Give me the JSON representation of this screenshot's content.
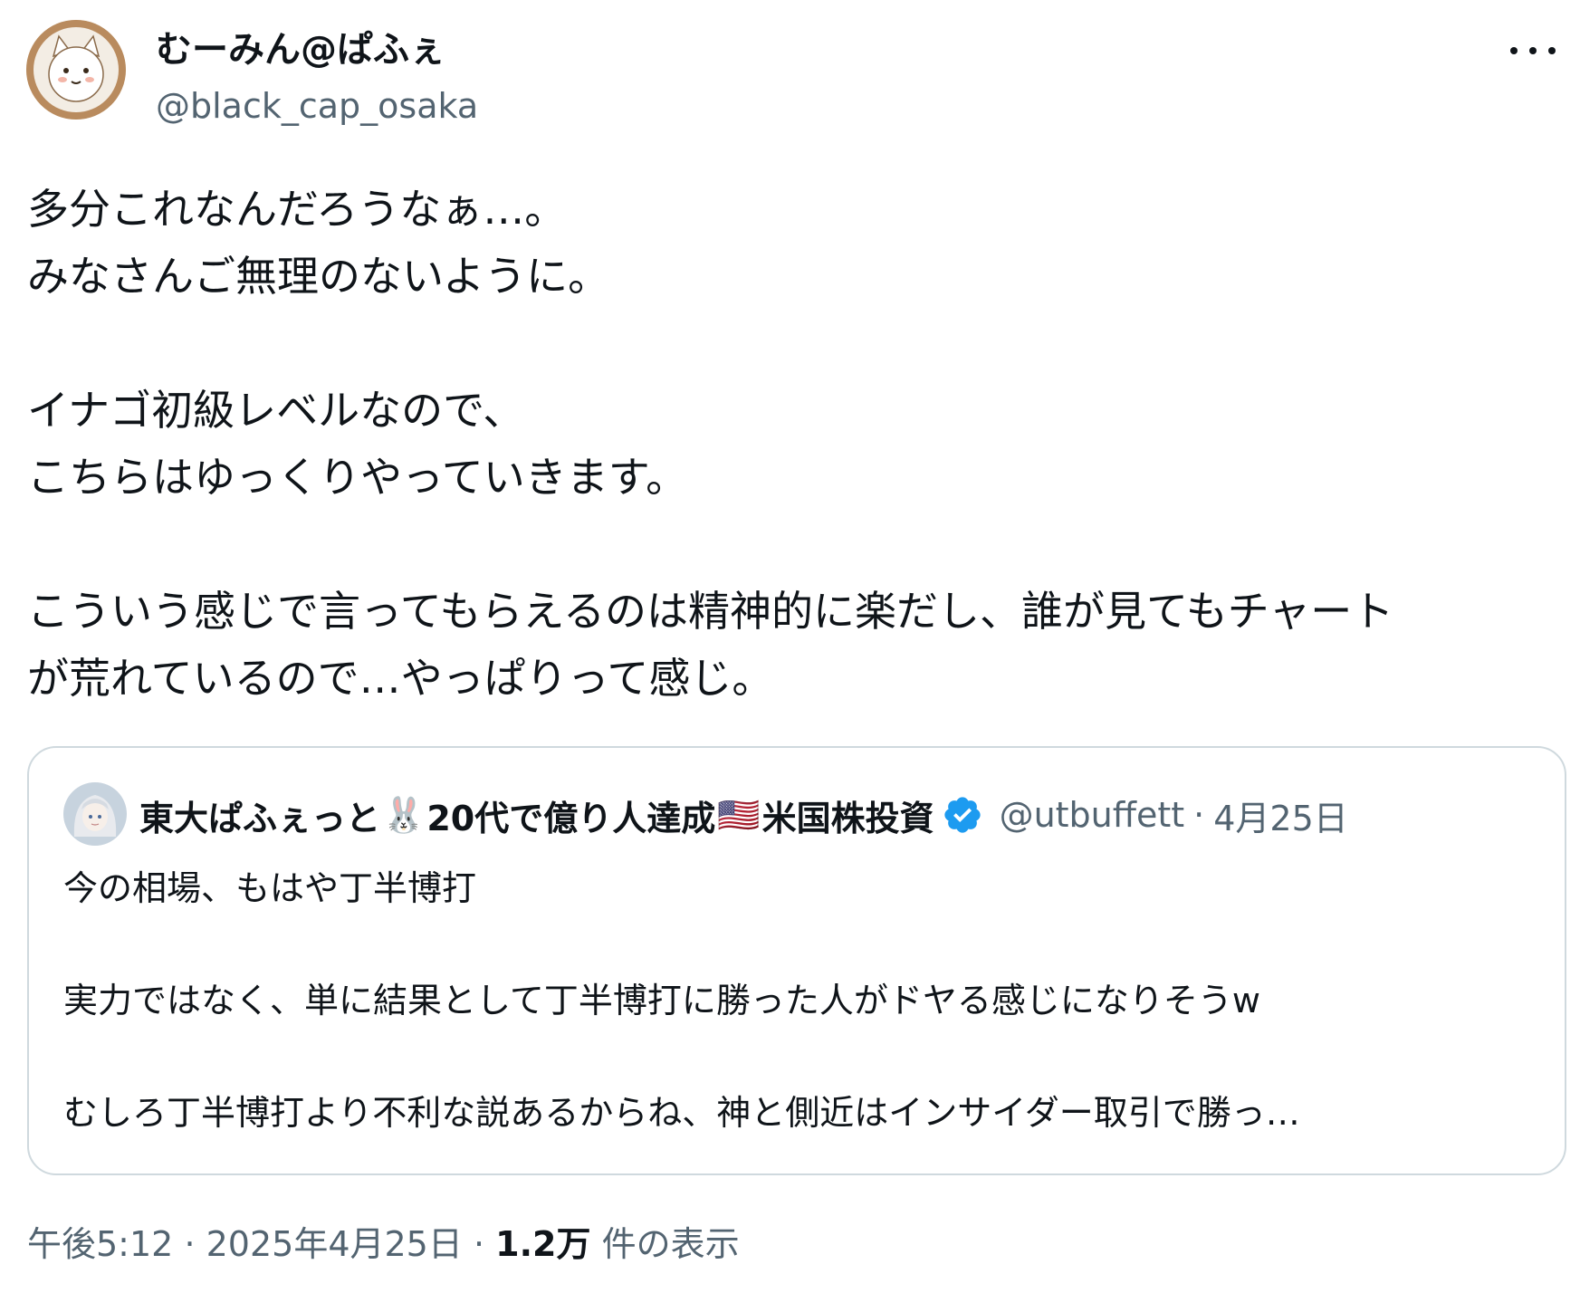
{
  "author": {
    "display_name": "むーみん@ぱふぇ",
    "handle": "@black_cap_osaka",
    "avatar_icon": "cat-avatar-icon"
  },
  "more_icon": "more-horizontal-icon",
  "tweet": {
    "lines": [
      "多分これなんだろうなぁ…。",
      "みなさんご無理のないように。",
      "",
      "イナゴ初級レベルなので、",
      "こちらはゆっくりやっていきます。",
      "",
      "こういう感じで言ってもらえるのは精神的に楽だし、誰が見てもチャート",
      "が荒れているので…やっぱりって感じ。"
    ]
  },
  "quote": {
    "name_part1": "東大ぱふぇっと",
    "emoji_rabbit": "🐰",
    "name_part2": "20代で億り人達成",
    "emoji_flag": "🇺🇸",
    "name_part3": "米国株投資",
    "verified_icon": "verified-badge-icon",
    "handle": "@utbuffett",
    "separator": "·",
    "date": "4月25日",
    "avatar_icon": "anime-girl-avatar-icon",
    "lines": [
      "今の相場、もはや丁半博打",
      "",
      "実力ではなく、単に結果として丁半博打に勝った人がドヤる感じになりそうw",
      "",
      "むしろ丁半博打より不利な説あるからね、神と側近はインサイダー取引で勝っ…"
    ]
  },
  "footer": {
    "time": "午後5:12",
    "sep1": "·",
    "date": "2025年4月25日",
    "sep2": "·",
    "views_count": "1.2万",
    "views_label": "件の表示"
  },
  "colors": {
    "text": "#0f1419",
    "secondary": "#536471",
    "border": "#cfd9de",
    "verified": "#1d9bf0"
  }
}
